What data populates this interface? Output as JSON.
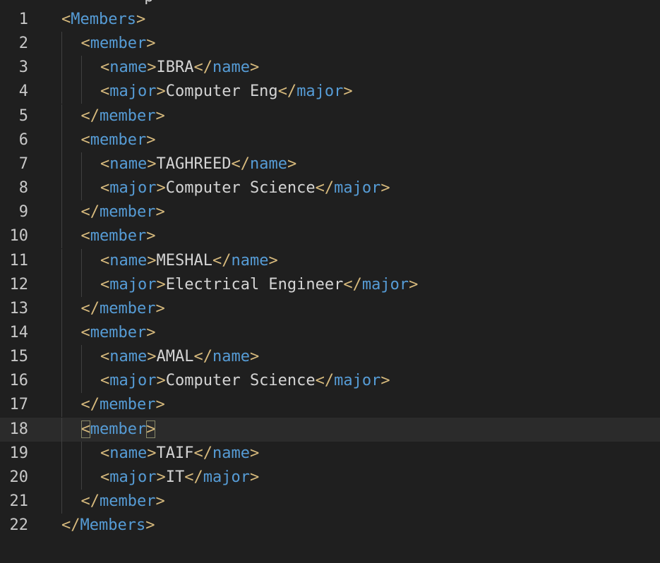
{
  "editor": {
    "top_fragment": "_    p",
    "current_line": 18,
    "lines": [
      {
        "n": "1",
        "tag": "Members",
        "kind": "open"
      },
      {
        "n": "2",
        "tag": "member",
        "kind": "open"
      },
      {
        "n": "3",
        "tag": "name",
        "kind": "pair",
        "text": "IBRA"
      },
      {
        "n": "4",
        "tag": "major",
        "kind": "pair",
        "text": "Computer Eng"
      },
      {
        "n": "5",
        "tag": "member",
        "kind": "close"
      },
      {
        "n": "6",
        "tag": "member",
        "kind": "open"
      },
      {
        "n": "7",
        "tag": "name",
        "kind": "pair",
        "text": "TAGHREED"
      },
      {
        "n": "8",
        "tag": "major",
        "kind": "pair",
        "text": "Computer Science"
      },
      {
        "n": "9",
        "tag": "member",
        "kind": "close"
      },
      {
        "n": "10",
        "tag": "member",
        "kind": "open"
      },
      {
        "n": "11",
        "tag": "name",
        "kind": "pair",
        "text": "MESHAL"
      },
      {
        "n": "12",
        "tag": "major",
        "kind": "pair",
        "text": "Electrical Engineer"
      },
      {
        "n": "13",
        "tag": "member",
        "kind": "close"
      },
      {
        "n": "14",
        "tag": "member",
        "kind": "open"
      },
      {
        "n": "15",
        "tag": "name",
        "kind": "pair",
        "text": "AMAL"
      },
      {
        "n": "16",
        "tag": "major",
        "kind": "pair",
        "text": "Computer Science"
      },
      {
        "n": "17",
        "tag": "member",
        "kind": "close"
      },
      {
        "n": "18",
        "tag": "member",
        "kind": "open"
      },
      {
        "n": "19",
        "tag": "name",
        "kind": "pair",
        "text": "TAIF"
      },
      {
        "n": "20",
        "tag": "major",
        "kind": "pair",
        "text": "IT"
      },
      {
        "n": "21",
        "tag": "member",
        "kind": "close"
      },
      {
        "n": "22",
        "tag": "Members",
        "kind": "close"
      }
    ]
  }
}
